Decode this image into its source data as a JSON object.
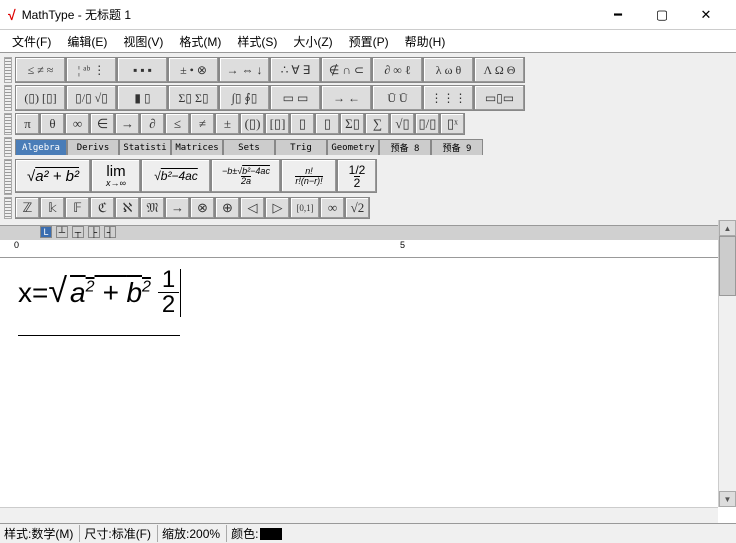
{
  "window": {
    "title": "MathType - 无标题 1"
  },
  "menu": {
    "file": "文件(F)",
    "edit": "编辑(E)",
    "view": "视图(V)",
    "format": "格式(M)",
    "style": "样式(S)",
    "size": "大小(Z)",
    "prefs": "预置(P)",
    "help": "帮助(H)"
  },
  "palette_row1": [
    "≤ ≠ ≈",
    "¦ ᵃᵇ ⋮",
    "▪ ▪ ▪",
    "± • ⊗",
    "→ ⇔ ↓",
    "∴ ∀ ∃",
    "∉ ∩ ⊂",
    "∂ ∞ ℓ",
    "λ ω θ",
    "Λ Ω Θ"
  ],
  "palette_row2": [
    "(▯) [▯]",
    "▯/▯ √▯",
    "▮ ▯",
    "Σ▯ Σ▯",
    "∫▯ ∮▯",
    "▭ ▭",
    "→ ←",
    "Ū Ū",
    "⋮⋮⋮",
    "▭▯▭"
  ],
  "palette_row3": [
    "π",
    "θ",
    "∞",
    "∈",
    "→",
    "∂",
    "≤",
    "≠",
    "±",
    "(▯)",
    "[▯]",
    "▯",
    "▯",
    "Σ▯",
    "∑",
    "√▯",
    "▯/▯",
    "▯ˣ"
  ],
  "tabs": [
    "Algebra",
    "Derivs",
    "Statisti",
    "Matrices",
    "Sets",
    "Trig",
    "Geometry",
    "预备 8",
    "预备 9"
  ],
  "active_tab": 0,
  "templates": {
    "t1": "√(a²+b²)",
    "t2": "lim x→∞",
    "t3": "√(b²−4ac)",
    "t4": "(−b±√(b²−4ac))/2a",
    "t5": "n!/(r!(n−r)!)",
    "t6": "1/2"
  },
  "symrow": [
    "ℤ",
    "𝕜",
    "𝔽",
    "ℭ",
    "ℵ",
    "𝔐",
    "→",
    "⊗",
    "⊕",
    "◁",
    "▷",
    "[0,1]",
    "∞",
    "√2"
  ],
  "ruler": {
    "marks": [
      "0",
      "5"
    ],
    "tabmodes": [
      "L",
      "┴",
      "┬",
      "├",
      "┤"
    ]
  },
  "equation": {
    "lhs": "x=",
    "radicand": "a² + b²",
    "frac_num": "1",
    "frac_den": "2"
  },
  "status": {
    "style_label": "样式:",
    "style_val": "数学(M)",
    "size_label": "尺寸:",
    "size_val": "标准(F)",
    "zoom_label": "缩放:",
    "zoom_val": "200%",
    "color_label": "颜色:"
  }
}
